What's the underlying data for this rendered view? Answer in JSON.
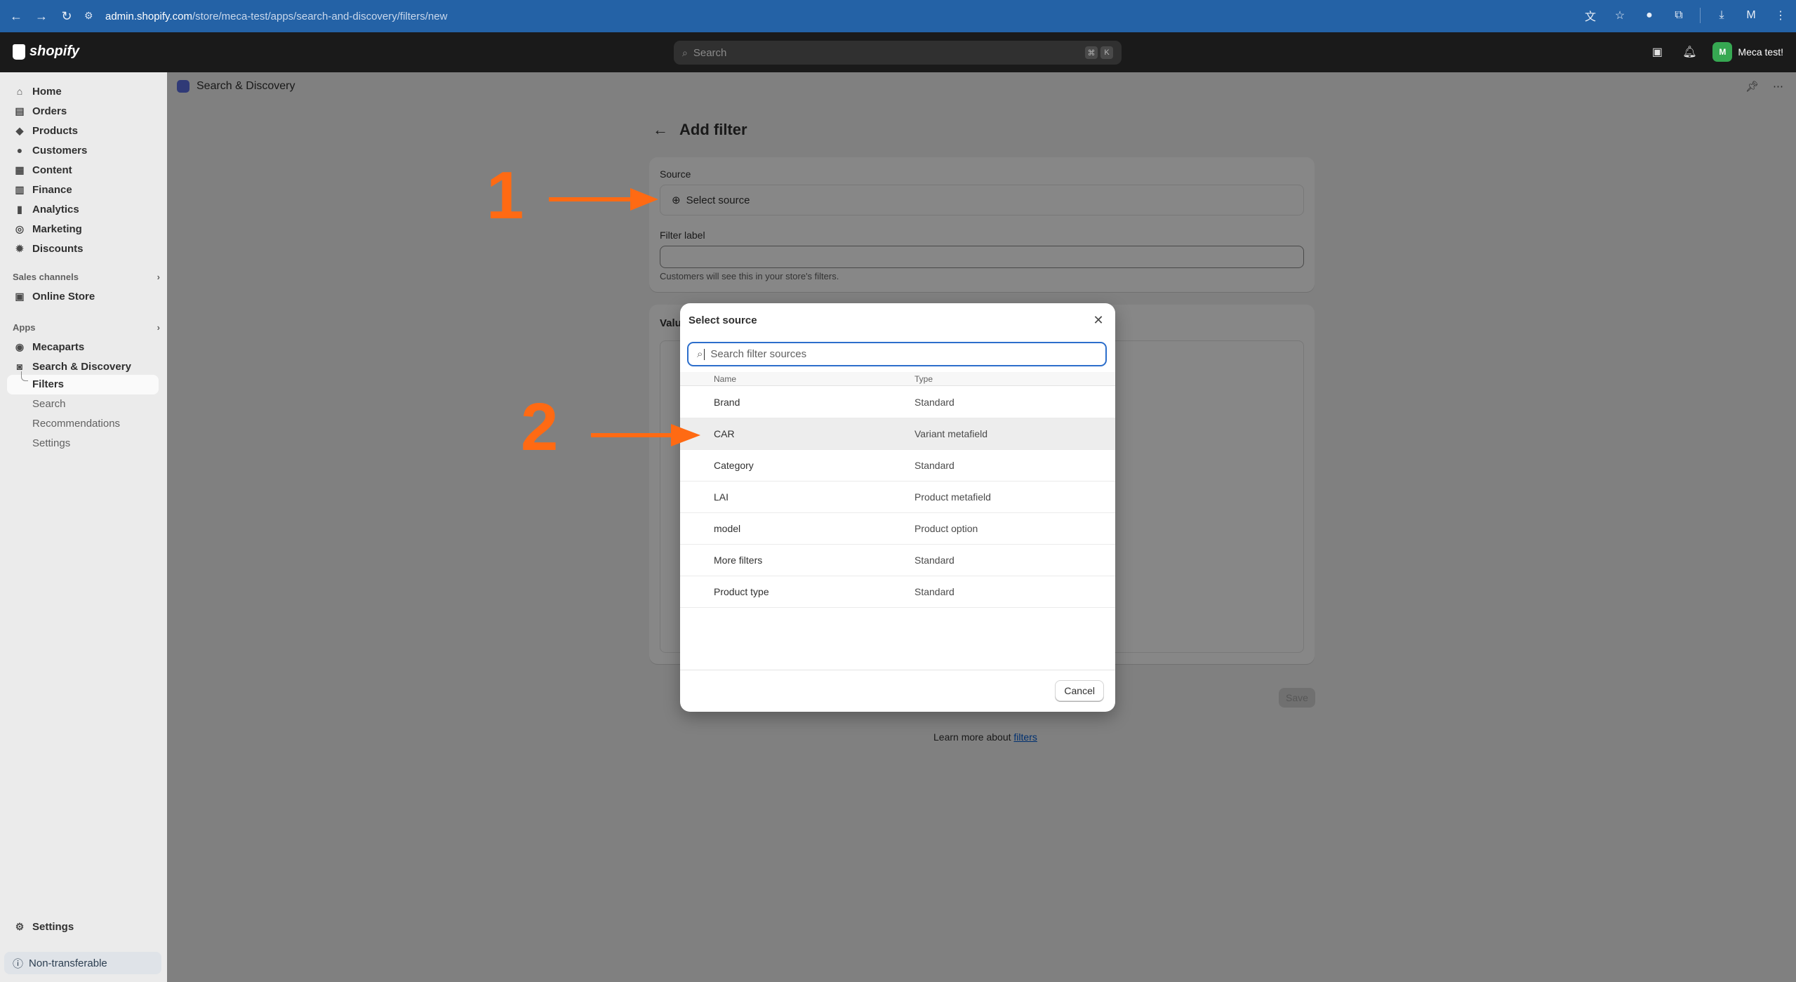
{
  "browser": {
    "url_host": "admin.shopify.com",
    "url_path": "/store/meca-test/apps/search-and-discovery/filters/new"
  },
  "topbar": {
    "logo": "shopify",
    "search_placeholder": "Search",
    "kbd1": "⌘",
    "kbd2": "K",
    "store_initials": "M",
    "store_name": "Meca test!"
  },
  "sidebar": {
    "items": [
      {
        "label": "Home",
        "icon": "home-icon"
      },
      {
        "label": "Orders",
        "icon": "orders-icon"
      },
      {
        "label": "Products",
        "icon": "tag-icon"
      },
      {
        "label": "Customers",
        "icon": "person-icon"
      },
      {
        "label": "Content",
        "icon": "content-icon"
      },
      {
        "label": "Finance",
        "icon": "bank-icon"
      },
      {
        "label": "Analytics",
        "icon": "chart-icon"
      },
      {
        "label": "Marketing",
        "icon": "target-icon"
      },
      {
        "label": "Discounts",
        "icon": "discount-icon"
      }
    ],
    "sales_channels_label": "Sales channels",
    "online_store": "Online Store",
    "apps_label": "Apps",
    "apps": [
      "Mecaparts",
      "Search & Discovery"
    ],
    "sub_items": [
      "Filters",
      "Search",
      "Recommendations",
      "Settings"
    ],
    "settings": "Settings",
    "badge": "Non-transferable"
  },
  "app_header": "Search & Discovery",
  "page": {
    "title": "Add filter",
    "source_label": "Source",
    "select_source": "Select source",
    "filter_label": "Filter label",
    "help_text": "Customers will see this in your store's filters.",
    "values_label": "Valu",
    "save": "Save",
    "learn_more": "Learn more about",
    "learn_link": "filters"
  },
  "modal": {
    "title": "Select source",
    "search_placeholder": "Search filter sources",
    "col_name": "Name",
    "col_type": "Type",
    "rows": [
      {
        "name": "Brand",
        "type": "Standard"
      },
      {
        "name": "CAR",
        "type": "Variant metafield"
      },
      {
        "name": "Category",
        "type": "Standard"
      },
      {
        "name": "LAI",
        "type": "Product metafield"
      },
      {
        "name": "model",
        "type": "Product option"
      },
      {
        "name": "More filters",
        "type": "Standard"
      },
      {
        "name": "Product type",
        "type": "Standard"
      }
    ],
    "cancel": "Cancel"
  },
  "annotations": {
    "one": "1",
    "two": "2",
    "color": "#ff6a13"
  }
}
